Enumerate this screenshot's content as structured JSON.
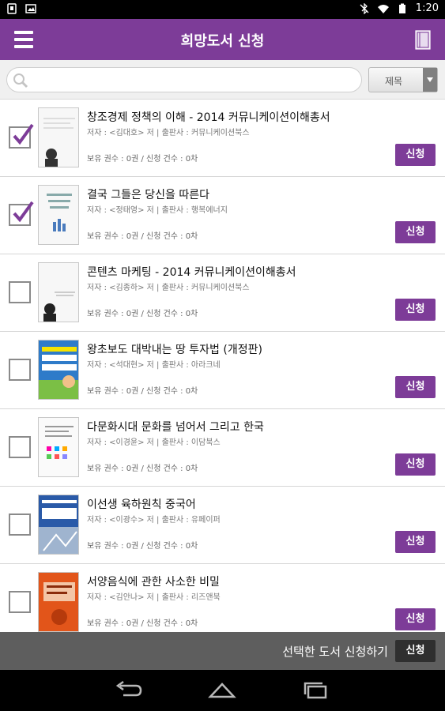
{
  "status_bar": {
    "time": "1:20"
  },
  "app_bar": {
    "title": "희망도서 신청",
    "menu_icon": "menu-icon",
    "book_icon": "book-icon"
  },
  "search": {
    "placeholder": "",
    "value": "",
    "filter_value": "제목"
  },
  "books": [
    {
      "title": "창조경제 정책의 이해 - 2014 커뮤니케이션이해총서",
      "meta": "저자 : <김대호> 저 | 출판사 : 커뮤니케이션북스",
      "count": "보유 권수 : 0권 / 신청 건수 : 0차",
      "checked": true,
      "apply_label": "신청",
      "cover_color": "#f7f7f7"
    },
    {
      "title": "결국 그들은 당신을 따른다",
      "meta": "저자 : <정태영> 저 | 출판사 : 행복에너지",
      "count": "보유 권수 : 0권 / 신청 건수 : 0차",
      "checked": true,
      "apply_label": "신청",
      "cover_color": "#f7f7f7"
    },
    {
      "title": "콘텐츠 마케팅 - 2014 커뮤니케이션이해총서",
      "meta": "저자 : <김종하> 저 | 출판사 : 커뮤니케이션북스",
      "count": "보유 권수 : 0권 / 신청 건수 : 0차",
      "checked": false,
      "apply_label": "신청",
      "cover_color": "#f7f7f7"
    },
    {
      "title": "왕초보도 대박내는 땅 투자법 (개정판)",
      "meta": "저자 : <석대현> 저 | 출판사 : 아라크네",
      "count": "보유 권수 : 0권 / 신청 건수 : 0차",
      "checked": false,
      "apply_label": "신청",
      "cover_color": "#2e7bc9"
    },
    {
      "title": "다문화시대 문화를 넘어서 그리고 한국",
      "meta": "저자 : <이경윤> 저 | 출판사 : 이담북스",
      "count": "보유 권수 : 0권 / 신청 건수 : 0차",
      "checked": false,
      "apply_label": "신청",
      "cover_color": "#fafafa"
    },
    {
      "title": "이선생 육하원칙 중국어",
      "meta": "저자 : <이광수> 저 | 출판사 : 유페이퍼",
      "count": "보유 권수 : 0권 / 신청 건수 : 0차",
      "checked": false,
      "apply_label": "신청",
      "cover_color": "#2a5aa8"
    },
    {
      "title": "서양음식에 관한 사소한 비밀",
      "meta": "저자 : <김안나> 저 | 출판사 : 리즈앤북",
      "count": "보유 권수 : 0권 / 신청 건수 : 0차",
      "checked": false,
      "apply_label": "신청",
      "cover_color": "#e2551a"
    }
  ],
  "action_bar": {
    "label": "선택한 도서 신청하기",
    "button_label": "신청"
  },
  "colors": {
    "accent": "#7d3c98",
    "action_bar": "#5e5e5e"
  }
}
